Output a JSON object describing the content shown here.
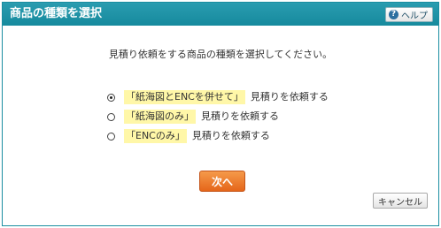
{
  "dialog": {
    "title": "商品の種類を選択",
    "help_label": "ヘルプ",
    "help_icon": "question-circle-icon"
  },
  "instruction": "見積り依頼をする商品の種類を選択してください。",
  "options": [
    {
      "highlight": "「紙海図とENCを併せて」",
      "suffix": "見積りを依頼する",
      "selected": true
    },
    {
      "highlight": "「紙海図のみ」",
      "suffix": "見積りを依頼する",
      "selected": false
    },
    {
      "highlight": "「ENCのみ」",
      "suffix": "見積りを依頼する",
      "selected": false
    }
  ],
  "buttons": {
    "next_label": "次へ",
    "cancel_label": "キャンセル"
  },
  "colors": {
    "titlebar": "#1a8da0",
    "highlight": "#fff7a8",
    "next_button": "#e87224"
  }
}
